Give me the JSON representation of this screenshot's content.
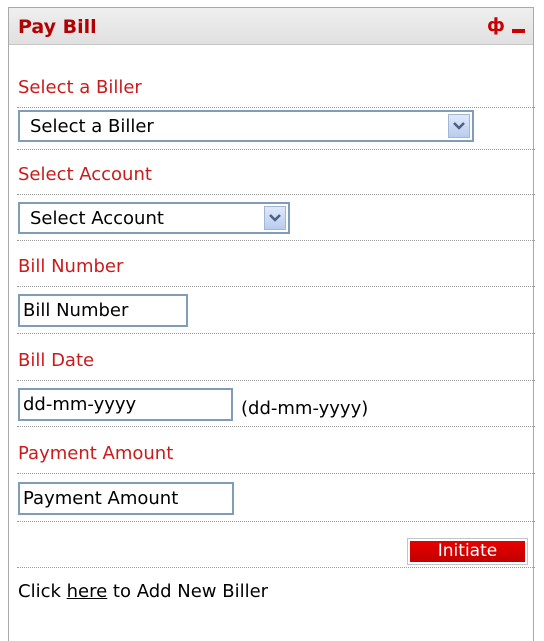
{
  "widget": {
    "title": "Pay Bill",
    "refresh_icon": "refresh-icon",
    "refresh_glyph": "ф",
    "minimize_icon": "minimize-icon"
  },
  "biller": {
    "label": "Select a Biller",
    "selected": "Select a Biller"
  },
  "account": {
    "label": "Select Account",
    "selected": "Select Account"
  },
  "bill_number": {
    "label": "Bill Number",
    "value": "Bill Number"
  },
  "bill_date": {
    "label": "Bill Date",
    "value": "dd-mm-yyyy",
    "format_hint": "(dd-mm-yyyy)"
  },
  "payment_amount": {
    "label": "Payment Amount",
    "value": "Payment Amount"
  },
  "actions": {
    "initiate_label": "Initiate"
  },
  "footer": {
    "prefix": "Click ",
    "link_text": "here",
    "suffix": " to Add New Biller"
  },
  "colors": {
    "title": "#b30000",
    "label": "#cc1a1a",
    "button": "#d40000",
    "input_border": "#7f9db9"
  }
}
